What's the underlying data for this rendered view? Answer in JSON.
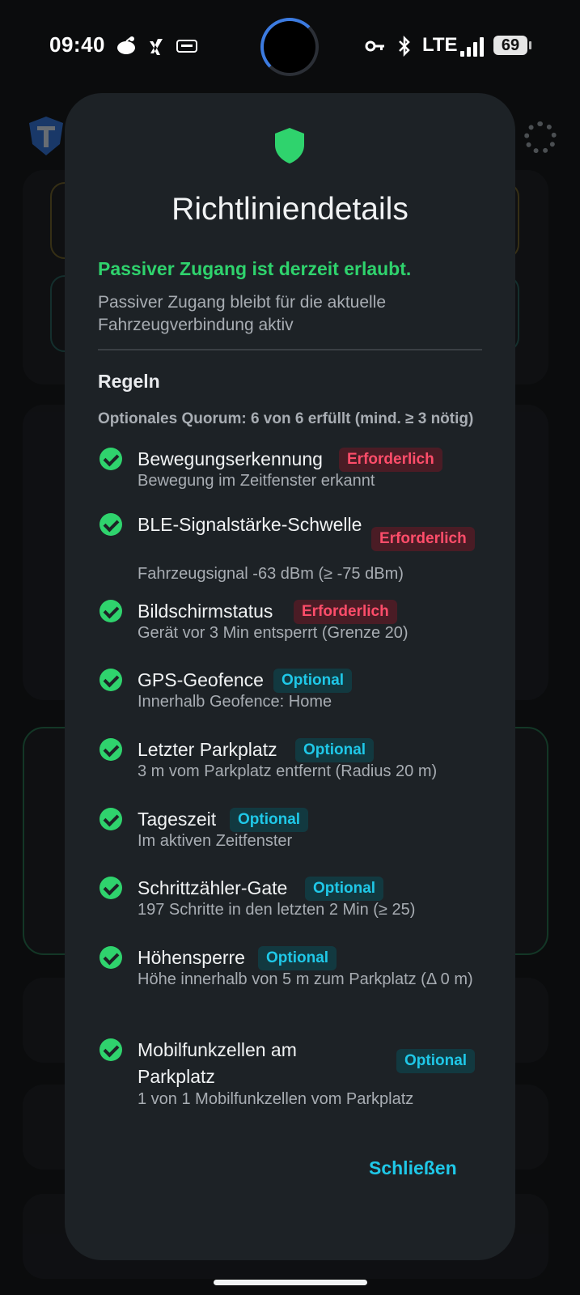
{
  "status_bar": {
    "time": "09:40",
    "network": "LTE",
    "battery": "69",
    "icons": [
      "reddit-icon",
      "xing-icon",
      "keyboard-icon",
      "key-icon",
      "bluetooth-icon",
      "signal-icon"
    ]
  },
  "dialog": {
    "icon": "shield-icon",
    "title": "Richtliniendetails",
    "status": "Passiver Zugang ist derzeit erlaubt.",
    "subtitle": "Passiver Zugang bleibt für die aktuelle Fahrzeugverbindung aktiv",
    "rules_heading": "Regeln",
    "quorum": "Optionales Quorum: 6 von 6 erfüllt (mind. ≥ 3 nötig)",
    "rules": [
      {
        "name": "Bewegungserkennung",
        "badge": "Erforderlich",
        "desc": "Bewegung im Zeitfenster erkannt"
      },
      {
        "name": "BLE-Signalstärke-Schwelle",
        "badge": "Erforderlich",
        "desc": "Fahrzeugsignal -63 dBm (≥ -75 dBm)"
      },
      {
        "name": "Bildschirmstatus",
        "badge": "Erforderlich",
        "desc": "Gerät vor 3 Min entsperrt (Grenze 20)"
      },
      {
        "name": "GPS-Geofence",
        "badge": "Optional",
        "desc": "Innerhalb Geofence: Home"
      },
      {
        "name": "Letzter Parkplatz",
        "badge": "Optional",
        "desc": "3 m vom Parkplatz entfernt (Radius 20 m)"
      },
      {
        "name": "Tageszeit",
        "badge": "Optional",
        "desc": "Im aktiven Zeitfenster"
      },
      {
        "name": "Schrittzähler-Gate",
        "badge": "Optional",
        "desc": "197 Schritte in den letzten 2 Min (≥ 25)"
      },
      {
        "name": "Höhensperre",
        "badge": "Optional",
        "desc": "Höhe innerhalb von 5 m zum Parkplatz (Δ 0 m)"
      },
      {
        "name": "Mobilfunkzellen am Parkplatz",
        "badge": "Optional",
        "desc": "1 von 1 Mobilfunkzellen vom Parkplatz"
      }
    ],
    "close_label": "Schließen"
  },
  "colors": {
    "ok_green": "#2fd36d",
    "required_red": "#ff4d6a",
    "optional_cyan": "#1fc8e8",
    "dialog_bg": "#1d2226"
  }
}
